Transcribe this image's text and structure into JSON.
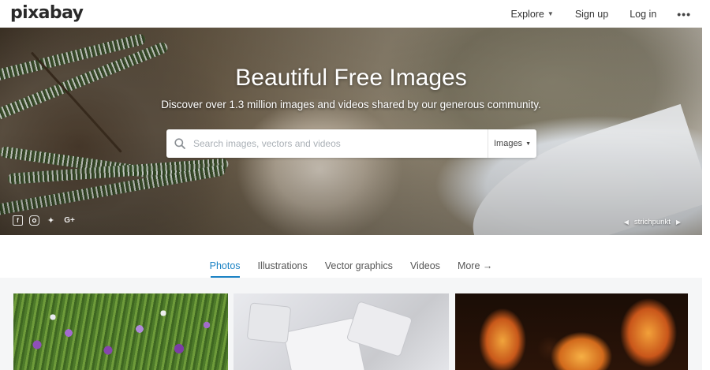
{
  "header": {
    "logo": "pixabay",
    "nav": {
      "explore": "Explore",
      "signup": "Sign up",
      "login": "Log in",
      "more": "•••"
    }
  },
  "hero": {
    "title": "Beautiful Free Images",
    "subtitle": "Discover over 1.3 million images and videos shared by our generous community.",
    "search": {
      "placeholder": "Search images, vectors and videos",
      "value": "",
      "type_selected": "Images"
    },
    "social_icons": [
      "facebook-icon",
      "instagram-icon",
      "twitter-icon",
      "google-plus-icon"
    ],
    "credit": "strichpunkt"
  },
  "tabs": [
    {
      "label": "Photos",
      "active": true
    },
    {
      "label": "Illustrations",
      "active": false
    },
    {
      "label": "Vector graphics",
      "active": false
    },
    {
      "label": "Videos",
      "active": false
    },
    {
      "label": "More →",
      "active": false
    }
  ],
  "colors": {
    "accent": "#1a82c4",
    "text": "#333333"
  }
}
